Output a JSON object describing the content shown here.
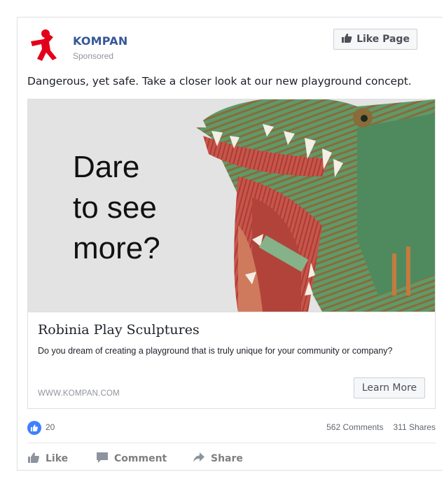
{
  "post": {
    "page_name": "KOMPAN",
    "sponsored_label": "Sponsored",
    "like_page_label": "Like Page",
    "text": "Dangerous, yet safe. Take a closer look at our new playground concept."
  },
  "card": {
    "headline_lines": [
      "Dare",
      "to see",
      "more?"
    ],
    "title": "Robinia Play Sculptures",
    "description": "Do you dream of creating a playground that is truly unique for your community or company?",
    "domain": "WWW.KOMPAN.COM",
    "cta_label": "Learn More"
  },
  "stats": {
    "reactions": "20",
    "comments": "562 Comments",
    "shares": "311 Shares"
  },
  "actions": {
    "like": "Like",
    "comment": "Comment",
    "share": "Share"
  },
  "colors": {
    "brand_red": "#e3001b",
    "link_blue": "#365899",
    "like_blue": "#4080ff"
  },
  "icons": {
    "logo": "kompan-figure-logo",
    "like_page": "thumbs-up-icon",
    "reaction": "like-reaction-icon",
    "comment": "comment-bubble-icon",
    "share": "share-arrow-icon"
  }
}
